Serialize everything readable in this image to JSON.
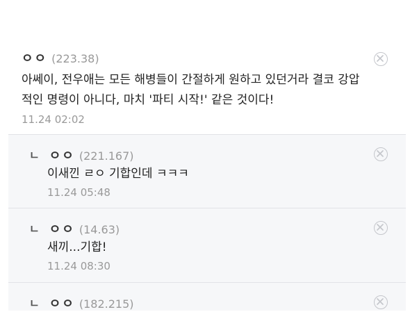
{
  "comments": [
    {
      "nick": "ㅇㅇ",
      "ip": "(223.38)",
      "lines": [
        "아쎄이, 전우애는 모든 해병들이 간절하게 원하고 있던거라 결코 강압",
        "적인 명령이 아니다, 마치 '파티 시작!' 같은 것이다!"
      ],
      "date": "11.24 02:02"
    },
    {
      "reply_mark": "ㄴ",
      "nick": "ㅇㅇ",
      "ip": "(221.167)",
      "text": "이새낀 ㄹㅇ 기합인데 ㅋㅋㅋ",
      "date": "11.24 05:48"
    },
    {
      "reply_mark": "ㄴ",
      "nick": "ㅇㅇ",
      "ip": "(14.63)",
      "text": "새끼...기합!",
      "date": "11.24 08:30"
    },
    {
      "reply_mark": "ㄴ",
      "nick": "ㅇㅇ",
      "ip": "(182.215)"
    }
  ],
  "icons": {
    "delete": "close-circle-icon",
    "reply": "reply-arrow-icon"
  }
}
